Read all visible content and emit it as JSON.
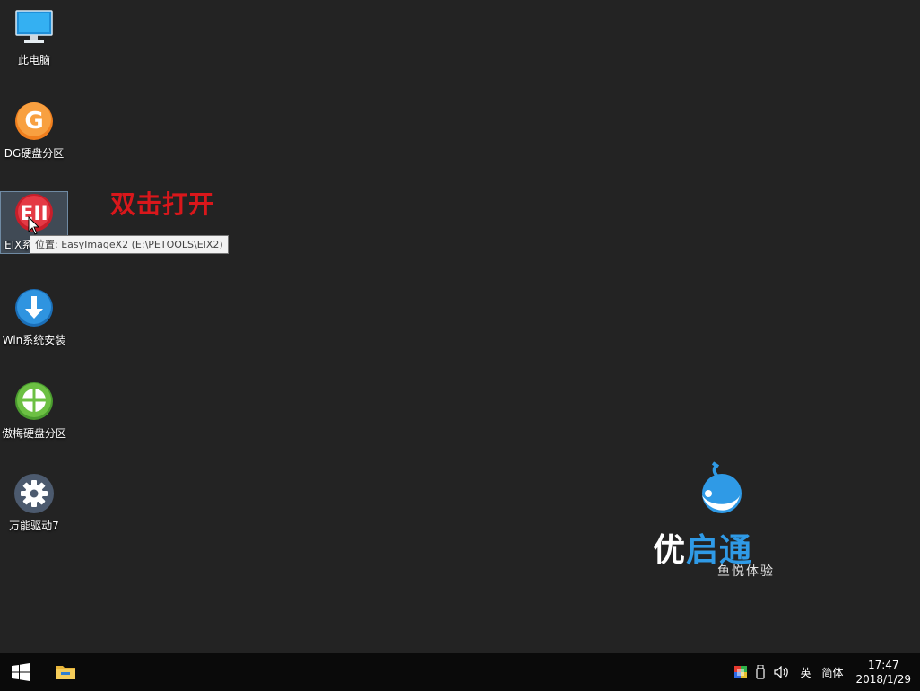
{
  "desktop": {
    "icons": [
      {
        "label": "此电脑",
        "icon": "computer-icon"
      },
      {
        "label": "DG硬盘分区",
        "icon": "diskgenius-icon"
      },
      {
        "label": "EIX系统安装",
        "icon": "eix-icon"
      },
      {
        "label": "Win系统安装",
        "icon": "download-arrow-icon"
      },
      {
        "label": "傲梅硬盘分区",
        "icon": "partition-pie-icon"
      },
      {
        "label": "万能驱动7",
        "icon": "gear-icon"
      }
    ],
    "visible_label_eix": "EIX系",
    "tooltip": "位置: EasyImageX2 (E:\\PETOOLS\\EIX2)",
    "annotation": "双击打开"
  },
  "brand": {
    "title_part1": "优",
    "title_part2": "启通",
    "subtitle": "鱼悦体验",
    "accent_color": "#2f9ae6"
  },
  "taskbar": {
    "ime_lang": "英",
    "ime_mode": "简体",
    "time": "17:47",
    "date": "2018/1/29"
  }
}
